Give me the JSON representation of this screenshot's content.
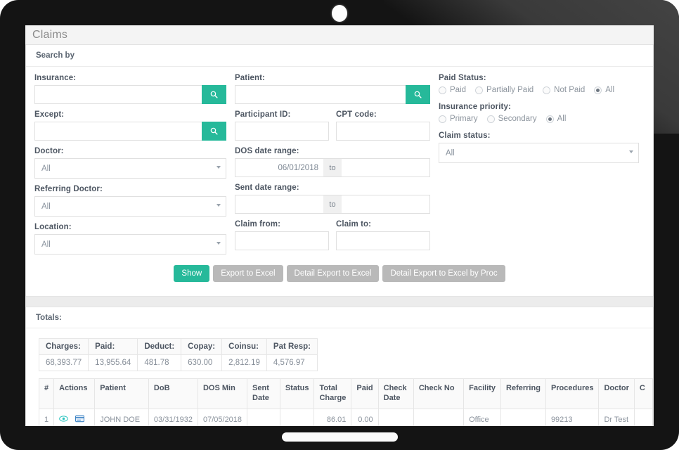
{
  "header": {
    "title": "Claims"
  },
  "search_panel": {
    "section_label": "Search by",
    "insurance": {
      "label": "Insurance:",
      "value": "",
      "search_icon": "search-icon"
    },
    "patient": {
      "label": "Patient:",
      "value": "",
      "search_icon": "search-icon"
    },
    "except": {
      "label": "Except:",
      "value": "",
      "search_icon": "search-icon"
    },
    "participant_id": {
      "label": "Participant ID:",
      "value": ""
    },
    "cpt_code": {
      "label": "CPT code:",
      "value": ""
    },
    "doctor": {
      "label": "Doctor:",
      "value": "All"
    },
    "referring_doctor": {
      "label": "Referring Doctor:",
      "value": "All"
    },
    "location": {
      "label": "Location:",
      "value": "All"
    },
    "dos_date_range": {
      "label": "DOS date range:",
      "from": "06/01/2018",
      "to_label": "to",
      "to": ""
    },
    "sent_date_range": {
      "label": "Sent date range:",
      "from": "",
      "to_label": "to",
      "to": ""
    },
    "claim_from": {
      "label": "Claim from:",
      "value": ""
    },
    "claim_to": {
      "label": "Claim to:",
      "value": ""
    },
    "paid_status": {
      "label": "Paid Status:",
      "options": [
        {
          "label": "Paid",
          "selected": false
        },
        {
          "label": "Partially Paid",
          "selected": false
        },
        {
          "label": "Not Paid",
          "selected": false
        },
        {
          "label": "All",
          "selected": true
        }
      ]
    },
    "insurance_priority": {
      "label": "Insurance priority:",
      "options": [
        {
          "label": "Primary",
          "selected": false
        },
        {
          "label": "Secondary",
          "selected": false
        },
        {
          "label": "All",
          "selected": true
        }
      ]
    },
    "claim_status": {
      "label": "Claim status:",
      "value": "All"
    },
    "buttons": [
      {
        "label": "Show",
        "style": "primary"
      },
      {
        "label": "Export to Excel",
        "style": "muted"
      },
      {
        "label": "Detail Export to Excel",
        "style": "muted"
      },
      {
        "label": "Detail Export to Excel by Proc",
        "style": "muted"
      }
    ]
  },
  "totals_panel": {
    "section_label": "Totals:",
    "headers": [
      "Charges:",
      "Paid:",
      "Deduct:",
      "Copay:",
      "Coinsu:",
      "Pat Resp:"
    ],
    "values": [
      "68,393.77",
      "13,955.64",
      "481.78",
      "630.00",
      "2,812.19",
      "4,576.97"
    ]
  },
  "grid": {
    "headers": [
      "#",
      "Actions",
      "Patient",
      "DoB",
      "DOS Min",
      "Sent Date",
      "Status",
      "Total Charge",
      "Paid",
      "Check Date",
      "Check No",
      "Facility",
      "Referring",
      "Procedures",
      "Doctor",
      "C"
    ],
    "rows": [
      {
        "num": "1",
        "actions": [
          "eye-icon",
          "card-icon"
        ],
        "patient": "JOHN DOE",
        "dob": "03/31/1932",
        "dos_min": "07/05/2018",
        "sent_date": "",
        "status": "",
        "total_charge": "86.01",
        "paid": "0.00",
        "check_date": "",
        "check_no": "",
        "facility": "Office",
        "referring": "",
        "procedures": "99213",
        "doctor": "Dr Test",
        "last": ""
      }
    ]
  },
  "colors": {
    "accent": "#26b99a",
    "muted_button": "#b9b9b9",
    "eye_icon": "#2ec5c0",
    "card_icon": "#3b82c4",
    "device": "#141414"
  }
}
